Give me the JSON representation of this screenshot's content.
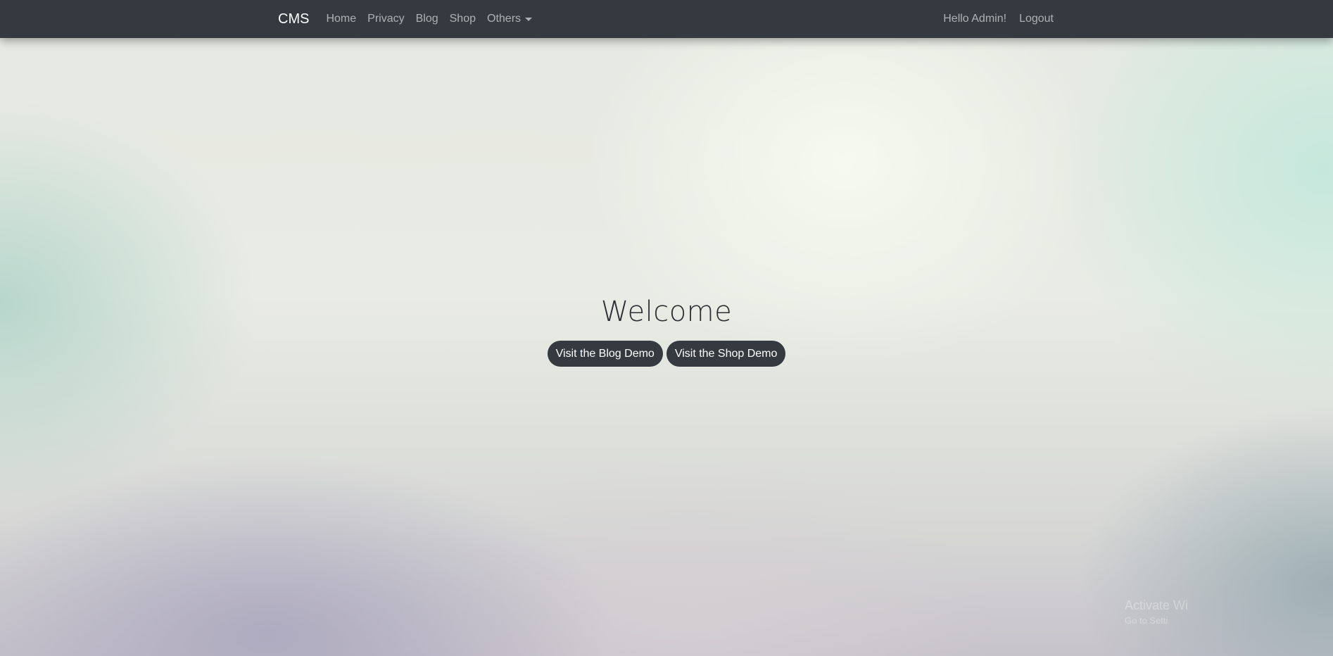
{
  "navbar": {
    "brand": "CMS",
    "links": [
      "Home",
      "Privacy",
      "Blog",
      "Shop",
      "Others"
    ],
    "greeting": "Hello Admin!",
    "logout": "Logout"
  },
  "hero": {
    "title": "Welcome",
    "buttons": [
      "Visit the Blog Demo",
      "Visit the Shop Demo"
    ]
  },
  "watermark": {
    "line1": "Activate Wi",
    "line2": "Go to Setti"
  },
  "colors": {
    "navbar_bg": "#343a40",
    "button_bg": "#343a40",
    "nav_link": "rgba(255,255,255,0.6)"
  },
  "icons": [
    "dropdown-caret-icon"
  ]
}
